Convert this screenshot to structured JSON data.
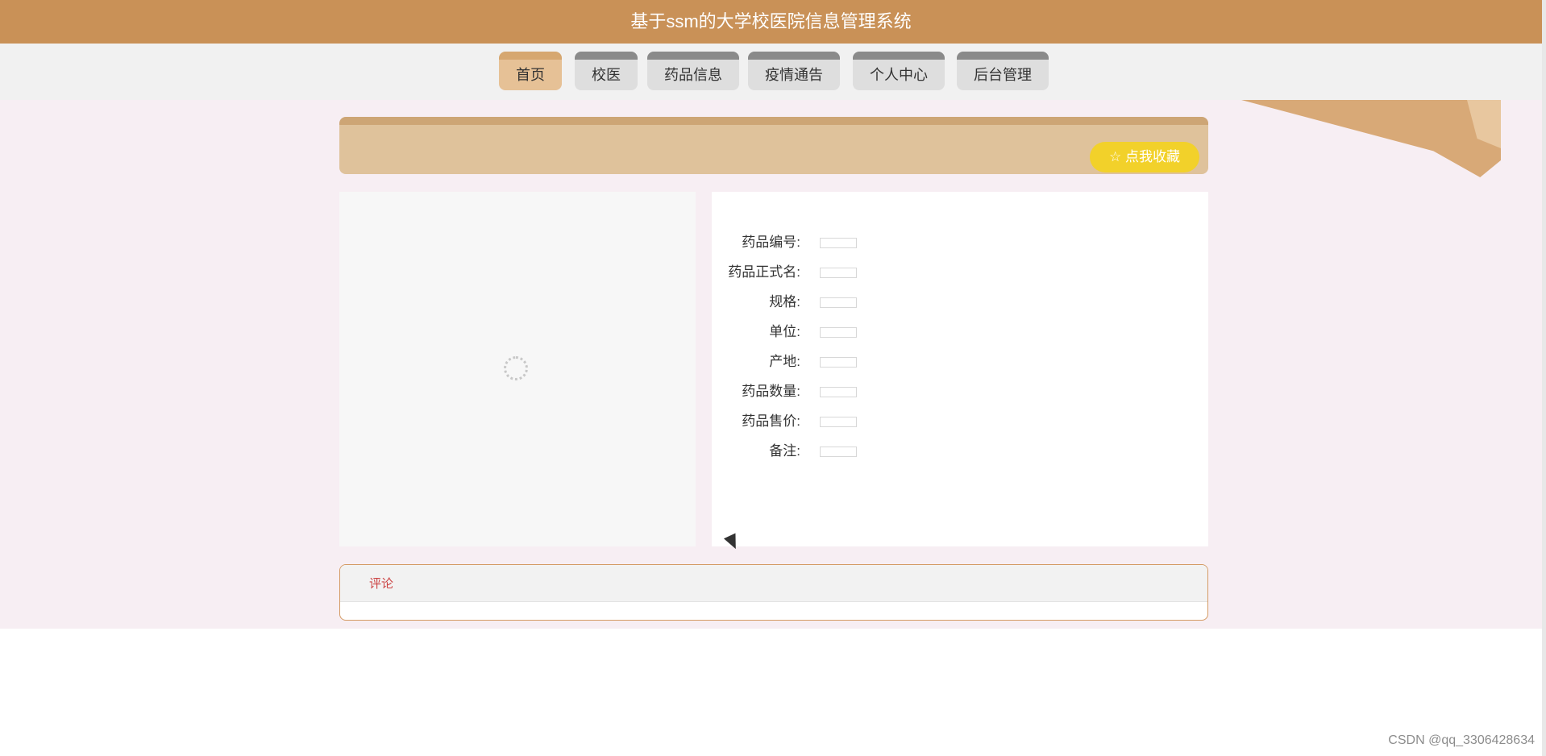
{
  "header": {
    "title": "基于ssm的大学校医院信息管理系统"
  },
  "nav": {
    "items": [
      {
        "label": "首页",
        "active": true
      },
      {
        "label": "校医",
        "active": false
      },
      {
        "label": "药品信息",
        "active": false
      },
      {
        "label": "疫情通告",
        "active": false
      },
      {
        "label": "个人中心",
        "active": false
      },
      {
        "label": "后台管理",
        "active": false
      }
    ]
  },
  "panel": {
    "favorite_button": "☆ 点我收藏"
  },
  "details": {
    "fields": [
      {
        "label": "药品编号:",
        "value": ""
      },
      {
        "label": "药品正式名:",
        "value": ""
      },
      {
        "label": "规格:",
        "value": ""
      },
      {
        "label": "单位:",
        "value": ""
      },
      {
        "label": "产地:",
        "value": ""
      },
      {
        "label": "药品数量:",
        "value": ""
      },
      {
        "label": "药品售价:",
        "value": ""
      },
      {
        "label": "备注:",
        "value": ""
      }
    ]
  },
  "comments": {
    "label": "评论"
  },
  "watermark": "CSDN @qq_3306428634",
  "colors": {
    "header": "#c99157",
    "nav_active": "#e6c196",
    "favorite": "#f2d12a",
    "comment_label": "#cc4444"
  }
}
